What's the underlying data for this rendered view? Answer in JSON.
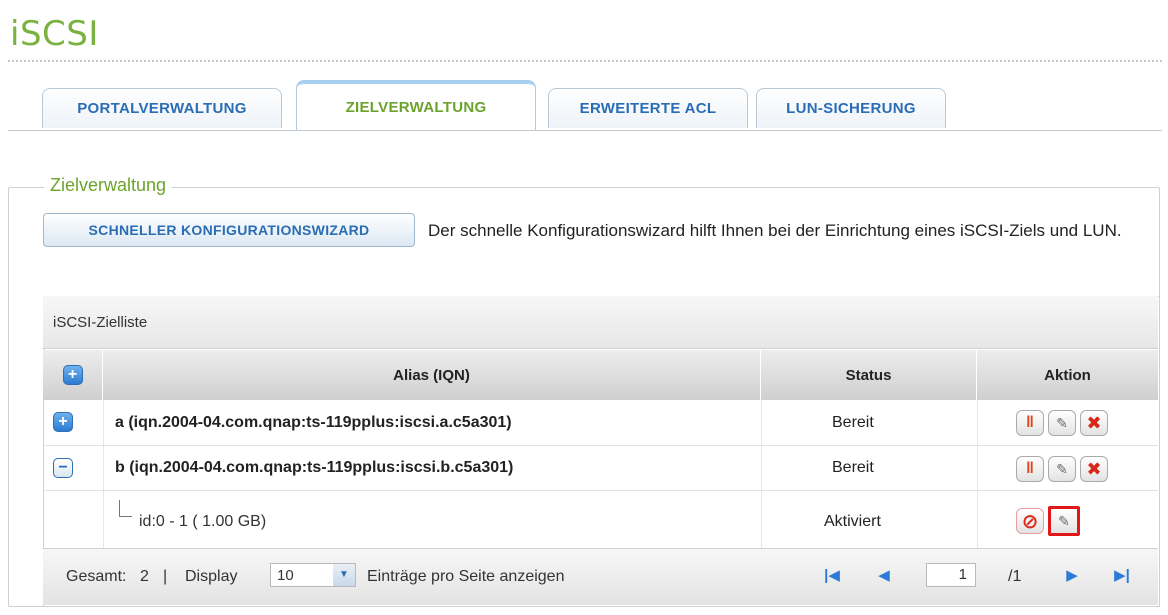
{
  "page": {
    "title": "iSCSI"
  },
  "tabs": [
    {
      "label": "PORTALVERWALTUNG",
      "active": false
    },
    {
      "label": "ZIELVERWALTUNG",
      "active": true
    },
    {
      "label": "ERWEITERTE ACL",
      "active": false
    },
    {
      "label": "LUN-SICHERUNG",
      "active": false
    }
  ],
  "section": {
    "legend": "Zielverwaltung",
    "wizard_button": "SCHNELLER KONFIGURATIONSWIZARD",
    "wizard_description": "Der schnelle Konfigurationswizard hilft Ihnen bei der Einrichtung eines iSCSI-Ziels und LUN."
  },
  "list": {
    "title": "iSCSI-Zielliste",
    "columns": {
      "add": "+",
      "alias": "Alias (IQN)",
      "status": "Status",
      "action": "Aktion"
    },
    "rows": [
      {
        "expander": "+",
        "alias": "a (iqn.2004-04.com.qnap:ts-119pplus:iscsi.a.c5a301)",
        "status": "Bereit"
      },
      {
        "expander": "−",
        "alias": "b (iqn.2004-04.com.qnap:ts-119pplus:iscsi.b.c5a301)",
        "status": "Bereit"
      }
    ],
    "sub_row": {
      "alias": "id:0 - 1 ( 1.00 GB)",
      "status": "Aktiviert"
    }
  },
  "icons": {
    "pause": "‖",
    "edit": "✎",
    "delete": "✖",
    "disable": "⊘",
    "first": "|◀",
    "prev": "◀",
    "next": "▶",
    "last": "▶|",
    "dropdown": "▼"
  },
  "footer": {
    "total_label": "Gesamt:",
    "total_value": "2",
    "separator": "|",
    "display_label": "Display",
    "display_value": "10",
    "per_page_label": "Einträge pro Seite anzeigen",
    "page_value": "1",
    "page_total": "/1"
  },
  "colors": {
    "accent_green": "#7ab23f",
    "tab_blue": "#2a6db5",
    "highlight_red": "#e0181a"
  }
}
